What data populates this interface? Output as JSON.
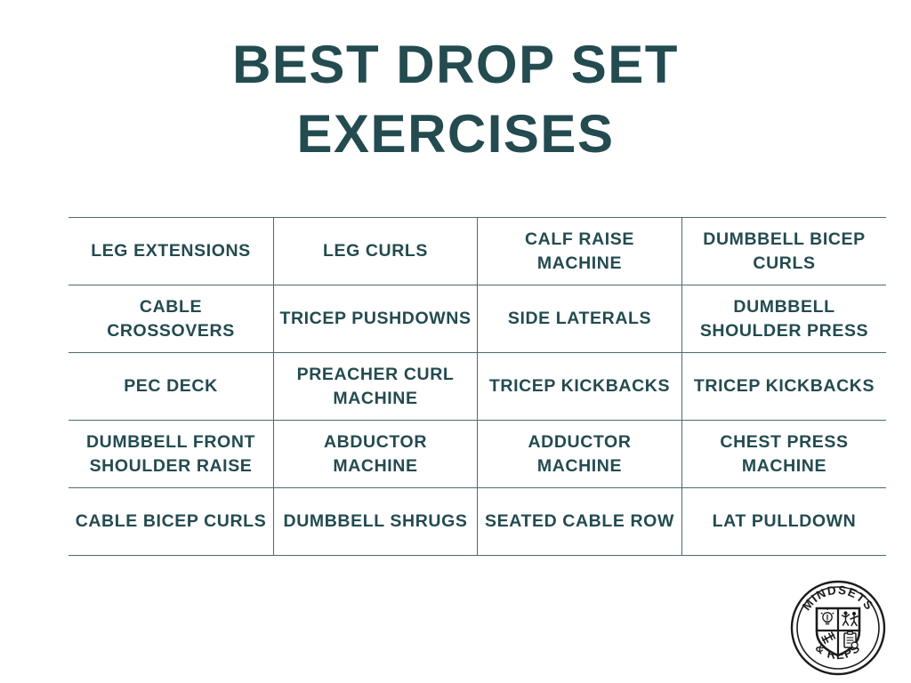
{
  "title": {
    "line1": "BEST DROP SET",
    "line2": "EXERCISES"
  },
  "colors": {
    "text": "#234b50",
    "rule": "#4e6b6d",
    "background": "#ffffff",
    "logo": "#1c1c1c"
  },
  "table": {
    "columns": 4,
    "rows": [
      [
        "LEG EXTENSIONS",
        "LEG CURLS",
        "CALF RAISE MACHINE",
        "DUMBBELL BICEP CURLS"
      ],
      [
        "CABLE CROSSOVERS",
        "TRICEP PUSHDOWNS",
        "SIDE LATERALS",
        "DUMBBELL SHOULDER PRESS"
      ],
      [
        "PEC DECK",
        "PREACHER CURL MACHINE",
        "TRICEP KICKBACKS",
        "TRICEP KICKBACKS"
      ],
      [
        "DUMBBELL FRONT SHOULDER RAISE",
        "ABDUCTOR MACHINE",
        "ADDUCTOR MACHINE",
        "CHEST PRESS MACHINE"
      ],
      [
        "CABLE BICEP CURLS",
        "DUMBBELL SHRUGS",
        "SEATED CABLE ROW",
        "LAT PULLDOWN"
      ]
    ]
  },
  "logo": {
    "name": "mindsets-and-reps-logo",
    "top_text": "MINDSETS",
    "bottom_text": "& REPS",
    "emblem_icons": [
      "lightbulb-icon",
      "exercise-figures-icon",
      "dumbbell-icon",
      "clipboard-icon"
    ]
  }
}
